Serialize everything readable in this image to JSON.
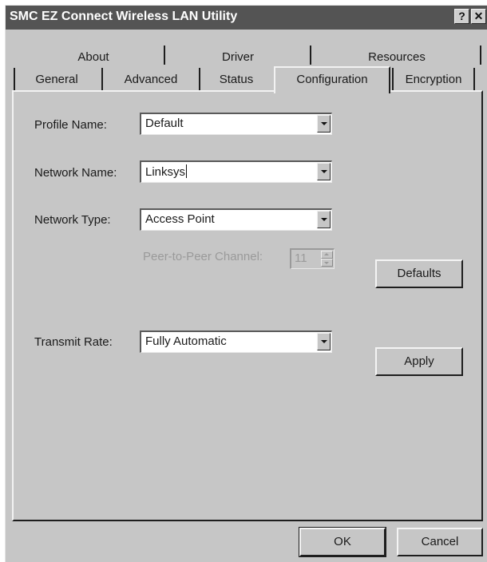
{
  "window": {
    "title": "SMC EZ Connect Wireless LAN Utility",
    "help_glyph": "?",
    "close_glyph": "✕"
  },
  "tabs": {
    "back_row": [
      "About",
      "Driver",
      "Resources"
    ],
    "front_row": [
      "General",
      "Advanced",
      "Status",
      "Configuration",
      "Encryption"
    ],
    "active": "Configuration"
  },
  "form": {
    "profile_name_label": "Profile Name:",
    "profile_name_value": "Default",
    "network_name_label": "Network Name:",
    "network_name_value": "Linksys",
    "network_type_label": "Network Type:",
    "network_type_value": "Access Point",
    "channel_label": "Peer-to-Peer Channel:",
    "channel_value": "11",
    "transmit_rate_label": "Transmit Rate:",
    "transmit_rate_value": "Fully Automatic"
  },
  "buttons": {
    "defaults": "Defaults",
    "apply": "Apply",
    "ok": "OK",
    "cancel": "Cancel"
  },
  "colors": {
    "titlebar": "#545454",
    "face": "#c6c6c6",
    "disabled_text": "#9a9a9a"
  }
}
